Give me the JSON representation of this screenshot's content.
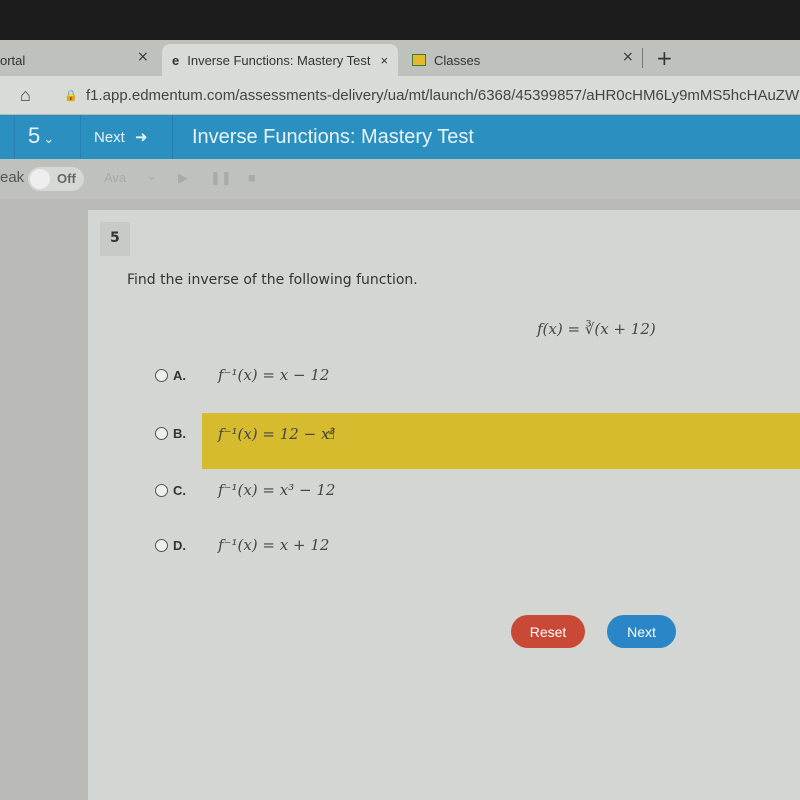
{
  "browser": {
    "tabs": [
      {
        "label": "ortal"
      },
      {
        "label": "Inverse Functions: Mastery Test",
        "active": true
      },
      {
        "label": "Classes"
      }
    ],
    "close_glyph": "×",
    "new_tab_glyph": "+",
    "url": "f1.app.edmentum.com/assessments-delivery/ua/mt/launch/6368/45399857/aHR0cHM6Ly9mMS5hcHAuZWRtZ"
  },
  "header": {
    "question_selector": "5",
    "next_label": "Next",
    "title": "Inverse Functions: Mastery Test",
    "color": "#2b8fc0"
  },
  "toolbar": {
    "speak_label": "eak",
    "toggle_label": "Off",
    "voice_label": "Ava"
  },
  "question": {
    "number": "5",
    "prompt": "Find the inverse of the following function.",
    "function": "f(x) = ∛(x + 12)",
    "options": [
      {
        "letter": "A.",
        "text": "f⁻¹(x) = x − 12"
      },
      {
        "letter": "B.",
        "text": "f⁻¹(x) = 12 − x³",
        "highlighted": true
      },
      {
        "letter": "C.",
        "text": "f⁻¹(x) = x³ − 12"
      },
      {
        "letter": "D.",
        "text": "f⁻¹(x) = x + 12"
      }
    ]
  },
  "buttons": {
    "reset": "Reset",
    "next": "Next",
    "reset_color": "#c84a36",
    "next_color": "#2a86c6"
  },
  "highlight_color": "#d7bb2f"
}
